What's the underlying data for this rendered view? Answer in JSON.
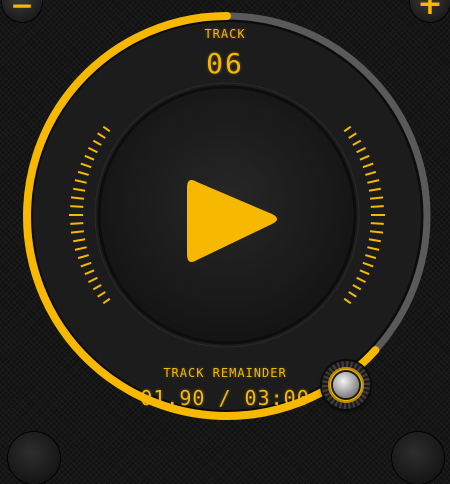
{
  "controls": {
    "volume_down_symbol": "−",
    "volume_up_symbol": "+"
  },
  "track": {
    "label": "TRACK",
    "number": "06"
  },
  "playback": {
    "state": "paused",
    "progress": 0.633,
    "remainder_label": "TRACK REMAINDER",
    "time_display": "01.90 / 03:00"
  },
  "colors": {
    "accent": "#F6B800",
    "track_unfilled": "#5A5A5A",
    "background": "#161616",
    "dial": "#1E1E1E"
  },
  "icons": {
    "play": "play-icon",
    "knob": "seek-knob-icon"
  }
}
